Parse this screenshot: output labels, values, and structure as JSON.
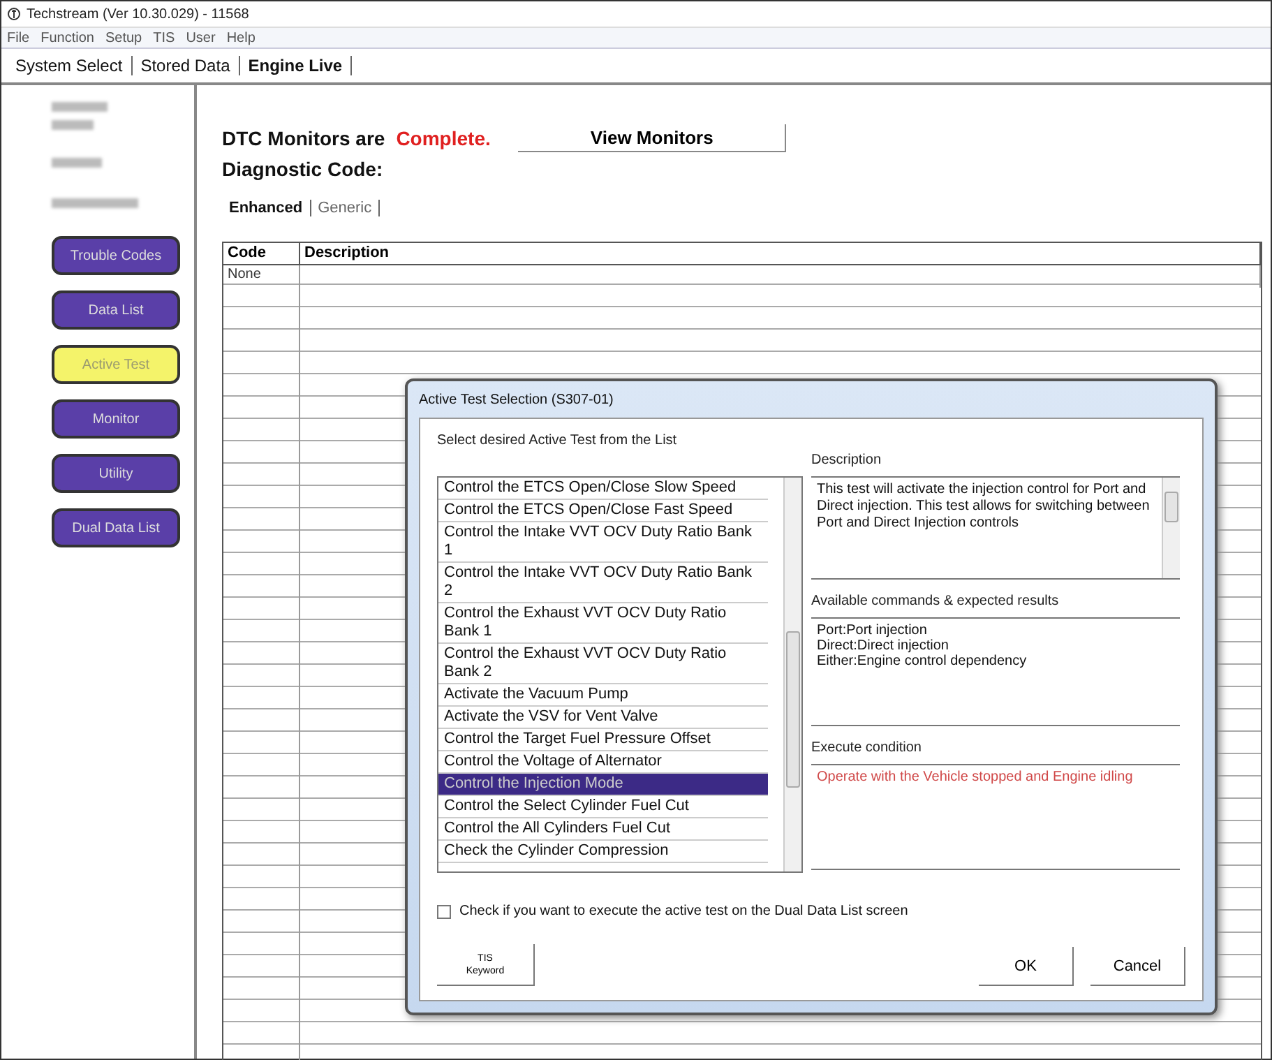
{
  "window": {
    "title": "Techstream (Ver 10.30.029) - 11568"
  },
  "menu": [
    "File",
    "Function",
    "Setup",
    "TIS",
    "User",
    "Help"
  ],
  "tabs": [
    {
      "label": "System Select",
      "selected": false
    },
    {
      "label": "Stored Data",
      "selected": false
    },
    {
      "label": "Engine Live",
      "selected": true
    }
  ],
  "sidebar": {
    "buttons": [
      {
        "label": "Trouble Codes",
        "selected": false
      },
      {
        "label": "Data List",
        "selected": false
      },
      {
        "label": "Active Test",
        "selected": true
      },
      {
        "label": "Monitor",
        "selected": false
      },
      {
        "label": "Utility",
        "selected": false
      },
      {
        "label": "Dual Data List",
        "selected": false
      }
    ]
  },
  "status": {
    "prefix": "DTC Monitors are",
    "value": "Complete.",
    "button": "View Monitors"
  },
  "diagnostic_label": "Diagnostic Code:",
  "code_tabs": [
    {
      "label": "Enhanced",
      "selected": true
    },
    {
      "label": "Generic",
      "selected": false
    }
  ],
  "table": {
    "columns": [
      "Code",
      "Description"
    ],
    "rows": [
      [
        "None",
        ""
      ]
    ]
  },
  "dialog": {
    "title": "Active Test Selection (S307-01)",
    "list_label": "Select desired Active Test from the List",
    "tests": [
      {
        "label": "Control the ETCS Open/Close Slow Speed",
        "selected": false
      },
      {
        "label": "Control the ETCS Open/Close Fast Speed",
        "selected": false
      },
      {
        "label": "Control the Intake VVT OCV Duty Ratio Bank 1",
        "selected": false
      },
      {
        "label": "Control the Intake VVT OCV Duty Ratio Bank 2",
        "selected": false
      },
      {
        "label": "Control the Exhaust VVT OCV Duty Ratio Bank 1",
        "selected": false
      },
      {
        "label": "Control the Exhaust VVT OCV Duty Ratio Bank 2",
        "selected": false
      },
      {
        "label": "Activate the Vacuum Pump",
        "selected": false
      },
      {
        "label": "Activate the VSV for Vent Valve",
        "selected": false
      },
      {
        "label": "Control the Target Fuel Pressure Offset",
        "selected": false
      },
      {
        "label": "Control the Voltage of Alternator",
        "selected": false
      },
      {
        "label": "Control the Injection Mode",
        "selected": true
      },
      {
        "label": "Control the Select Cylinder Fuel Cut",
        "selected": false
      },
      {
        "label": "Control the All Cylinders Fuel Cut",
        "selected": false
      },
      {
        "label": "Check the Cylinder Compression",
        "selected": false
      }
    ],
    "description_label": "Description",
    "description": "This test will activate the injection control for Port and Direct injection. This test allows for switching between Port and Direct Injection controls",
    "commands_label": "Available commands & expected results",
    "commands": [
      "Port:Port injection",
      "Direct:Direct injection",
      "Either:Engine control dependency"
    ],
    "condition_label": "Execute condition",
    "condition": "Operate with the Vehicle stopped and Engine idling",
    "dual_check": {
      "label": "Check if you want to execute the active test on the Dual Data List screen",
      "checked": false
    },
    "tis_button": [
      "TIS",
      "Keyword"
    ],
    "buttons": [
      "OK",
      "Cancel"
    ]
  }
}
